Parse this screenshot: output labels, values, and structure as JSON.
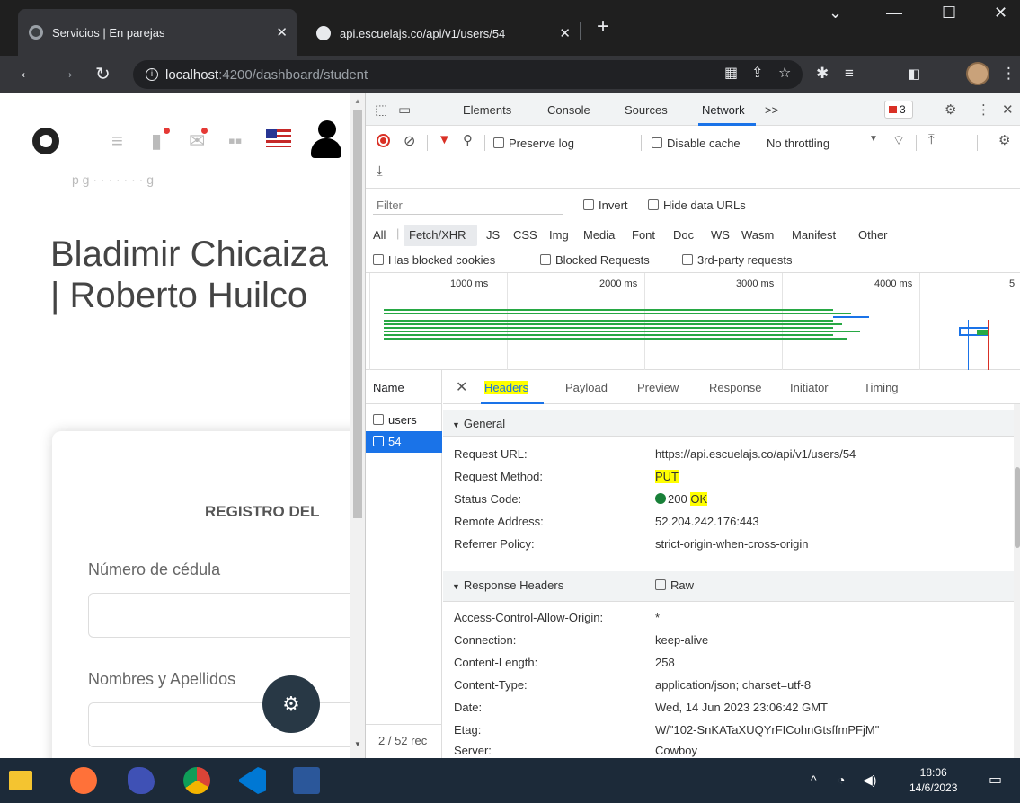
{
  "browser": {
    "tabs": [
      {
        "title": "Servicios | En parejas",
        "active": true
      },
      {
        "title": "api.escuelajs.co/api/v1/users/54",
        "active": false
      }
    ],
    "url_host": "localhost",
    "url_path": ":4200/dashboard/student"
  },
  "page": {
    "title": "Bladimir Chicaiza | Roberto Huilco",
    "card_title": "REGISTRO DEL",
    "fields": [
      {
        "label": "Número de cédula",
        "value": ""
      },
      {
        "label": "Nombres y Apellidos",
        "value": ""
      }
    ]
  },
  "devtools": {
    "tabs": [
      "Elements",
      "Console",
      "Sources",
      "Network"
    ],
    "active_tab": "Network",
    "more_tabs": ">>",
    "error_count": "3",
    "toolbar": {
      "preserve_log": "Preserve log",
      "disable_cache": "Disable cache",
      "throttling": "No throttling"
    },
    "filter": {
      "placeholder": "Filter",
      "invert": "Invert",
      "hide_data_urls": "Hide data URLs",
      "types": [
        "All",
        "Fetch/XHR",
        "JS",
        "CSS",
        "Img",
        "Media",
        "Font",
        "Doc",
        "WS",
        "Wasm",
        "Manifest",
        "Other"
      ],
      "selected_type": "Fetch/XHR",
      "has_blocked_cookies": "Has blocked cookies",
      "blocked_requests": "Blocked Requests",
      "third_party": "3rd-party requests"
    },
    "timeline": {
      "ticks": [
        "1000 ms",
        "2000 ms",
        "3000 ms",
        "4000 ms",
        "5"
      ]
    },
    "requests": {
      "header": "Name",
      "items": [
        {
          "name": "users",
          "selected": false
        },
        {
          "name": "54",
          "selected": true
        }
      ],
      "status": "2 / 52 rec"
    },
    "detail": {
      "tabs": [
        "Headers",
        "Payload",
        "Preview",
        "Response",
        "Initiator",
        "Timing"
      ],
      "active_tab": "Headers",
      "general_title": "General",
      "general": [
        {
          "key": "Request URL:",
          "value": "https://api.escuelajs.co/api/v1/users/54"
        },
        {
          "key": "Request Method:",
          "value": "PUT"
        },
        {
          "key": "Status Code:",
          "value": "200"
        },
        {
          "key": "Remote Address:",
          "value": "52.204.242.176:443"
        },
        {
          "key": "Referrer Policy:",
          "value": "strict-origin-when-cross-origin"
        }
      ],
      "status_text": "OK",
      "response_title": "Response Headers",
      "raw_label": "Raw",
      "response": [
        {
          "key": "Access-Control-Allow-Origin:",
          "value": "*"
        },
        {
          "key": "Connection:",
          "value": "keep-alive"
        },
        {
          "key": "Content-Length:",
          "value": "258"
        },
        {
          "key": "Content-Type:",
          "value": "application/json; charset=utf-8"
        },
        {
          "key": "Date:",
          "value": "Wed, 14 Jun 2023 23:06:42 GMT"
        },
        {
          "key": "Etag:",
          "value": "W/\"102-SnKATaXUQYrFICohnGtsffmPFjM\""
        },
        {
          "key": "Server:",
          "value": "Cowboy"
        }
      ]
    }
  },
  "taskbar": {
    "time": "18:06",
    "date": "14/6/2023"
  },
  "colors": {
    "accent": "#1a73e8",
    "highlight": "#ffff00",
    "status_ok": "#188038",
    "taskbar": "#1c2a39"
  }
}
